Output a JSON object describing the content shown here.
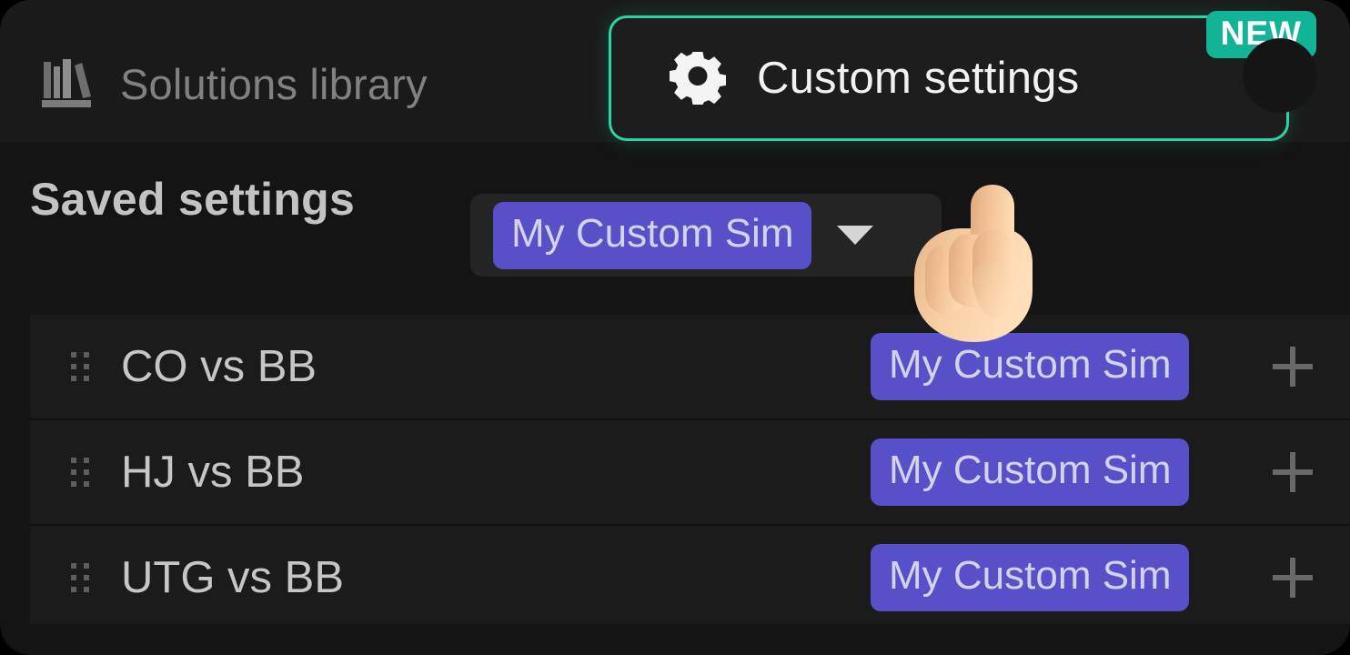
{
  "header": {
    "library_tab": {
      "label": "Solutions library",
      "icon": "library-icon"
    },
    "settings_tab": {
      "label": "Custom settings",
      "icon": "gear-icon",
      "badge": "NEW",
      "border_color": "#2bd4a4",
      "badge_color": "#12b498"
    }
  },
  "saved_settings": {
    "label": "Saved settings",
    "dropdown": {
      "selected": "My Custom Sim",
      "icon": "chevron-down-icon",
      "pill_color": "#5850c8"
    }
  },
  "list": {
    "rows": [
      {
        "name": "CO vs BB",
        "sim": "My Custom Sim",
        "add": "+"
      },
      {
        "name": "HJ vs BB",
        "sim": "My Custom Sim",
        "add": "+"
      },
      {
        "name": "UTG vs BB",
        "sim": "My Custom Sim",
        "add": "+"
      }
    ]
  },
  "cursor": {
    "icon": "pointing-up-hand-cursor"
  }
}
